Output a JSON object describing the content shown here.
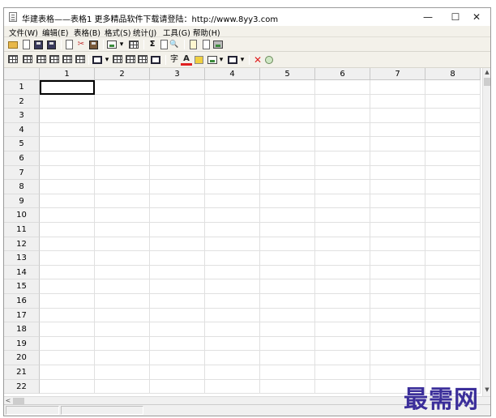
{
  "window": {
    "title": "华建表格——表格1    更多精品软件下载请登陆：http://www.8yy3.com",
    "controls": {
      "minimize": "—",
      "maximize": "☐",
      "close": "✕"
    }
  },
  "menu": [
    {
      "label": "文件(W)"
    },
    {
      "label": "编辑(E)"
    },
    {
      "label": "表格(B)"
    },
    {
      "label": "格式(S)"
    },
    {
      "label": "统计(J)"
    },
    {
      "label": "工具(G)"
    },
    {
      "label": "帮助(H)"
    }
  ],
  "toolbar1": {
    "sum_glyph": "Σ",
    "cut_glyph": "✂",
    "dropdown_glyph": "▾",
    "search_glyph": "🔍"
  },
  "toolbar2": {
    "delete_glyph": "✕",
    "font_color_glyph": "A",
    "dropdown_glyph": "▾",
    "text_glyph": "字"
  },
  "sheet": {
    "columns": [
      "1",
      "2",
      "3",
      "4",
      "5",
      "6",
      "7",
      "8"
    ],
    "rows": [
      "1",
      "2",
      "3",
      "4",
      "5",
      "6",
      "7",
      "8",
      "9",
      "10",
      "11",
      "12",
      "13",
      "14",
      "15",
      "16",
      "17",
      "18",
      "19",
      "20",
      "21",
      "22"
    ],
    "active_cell": "1,1"
  },
  "scroll": {
    "up": "▲",
    "down": "▼",
    "left": "<"
  },
  "watermark": "最需网"
}
